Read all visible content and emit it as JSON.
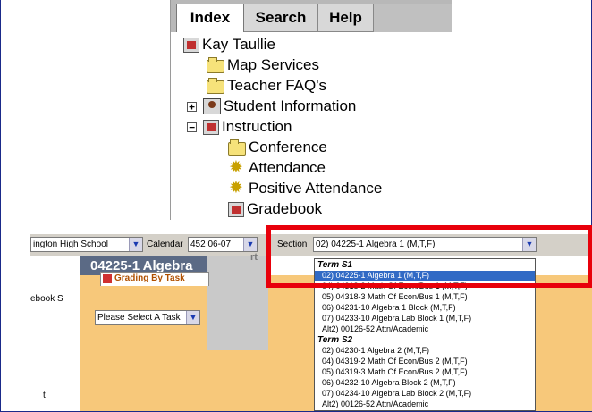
{
  "tabs": {
    "index": "Index",
    "search": "Search",
    "help": "Help"
  },
  "tree": {
    "root": "Kay Taullie",
    "items": [
      {
        "label": "Map Services",
        "icon": "folder-icon"
      },
      {
        "label": "Teacher FAQ's",
        "icon": "folder-group-icon"
      },
      {
        "label": "Student Information",
        "icon": "student-icon",
        "expander": "+"
      },
      {
        "label": "Instruction",
        "icon": "instruction-icon",
        "expander": "−"
      },
      {
        "label": "Conference",
        "icon": "folder-icon"
      },
      {
        "label": "Attendance",
        "icon": "sun-icon"
      },
      {
        "label": "Positive Attendance",
        "icon": "sun-icon"
      },
      {
        "label": "Gradebook",
        "icon": "gradebook-icon"
      }
    ]
  },
  "toolbar": {
    "school_value": "ington High School",
    "calendar_label": "Calendar",
    "calendar_value": "452 06-07",
    "section_label": "Section",
    "section_value": "02) 04225-1 Algebra 1 (M,T,F)"
  },
  "left": {
    "label1": "ebook S",
    "label2": "t"
  },
  "header": {
    "title": "04225-1 Algebra",
    "dim_text": "rt"
  },
  "grading_tab": {
    "label": "Grading By Task"
  },
  "task_select": {
    "value": "Please Select A Task"
  },
  "section_list": [
    {
      "text": "Term S1",
      "type": "group"
    },
    {
      "text": "02) 04225-1 Algebra 1 (M,T,F)",
      "type": "option",
      "selected": true
    },
    {
      "text": "04) 04318-2 Math Of Econ/Bus 1 (M,T,F)",
      "type": "option"
    },
    {
      "text": "05) 04318-3 Math Of Econ/Bus 1 (M,T,F)",
      "type": "option"
    },
    {
      "text": "06) 04231-10 Algebra 1 Block (M,T,F)",
      "type": "option"
    },
    {
      "text": "07) 04233-10 Algebra Lab Block 1 (M,T,F)",
      "type": "option"
    },
    {
      "text": "Alt2) 00126-52 Attn/Academic",
      "type": "option"
    },
    {
      "text": "Term S2",
      "type": "group"
    },
    {
      "text": "02) 04230-1 Algebra 2 (M,T,F)",
      "type": "option"
    },
    {
      "text": "04) 04319-2 Math Of Econ/Bus 2 (M,T,F)",
      "type": "option"
    },
    {
      "text": "05) 04319-3 Math Of Econ/Bus 2 (M,T,F)",
      "type": "option"
    },
    {
      "text": "06) 04232-10 Algebra Block 2 (M,T,F)",
      "type": "option"
    },
    {
      "text": "07) 04234-10 Algebra Lab Block 2 (M,T,F)",
      "type": "option"
    },
    {
      "text": "Alt2) 00126-52 Attn/Academic",
      "type": "option"
    }
  ],
  "colors": {
    "highlight": "#e8000b",
    "selection": "#316ac5",
    "panel": "#f7c87a",
    "header": "#5b6a85"
  }
}
